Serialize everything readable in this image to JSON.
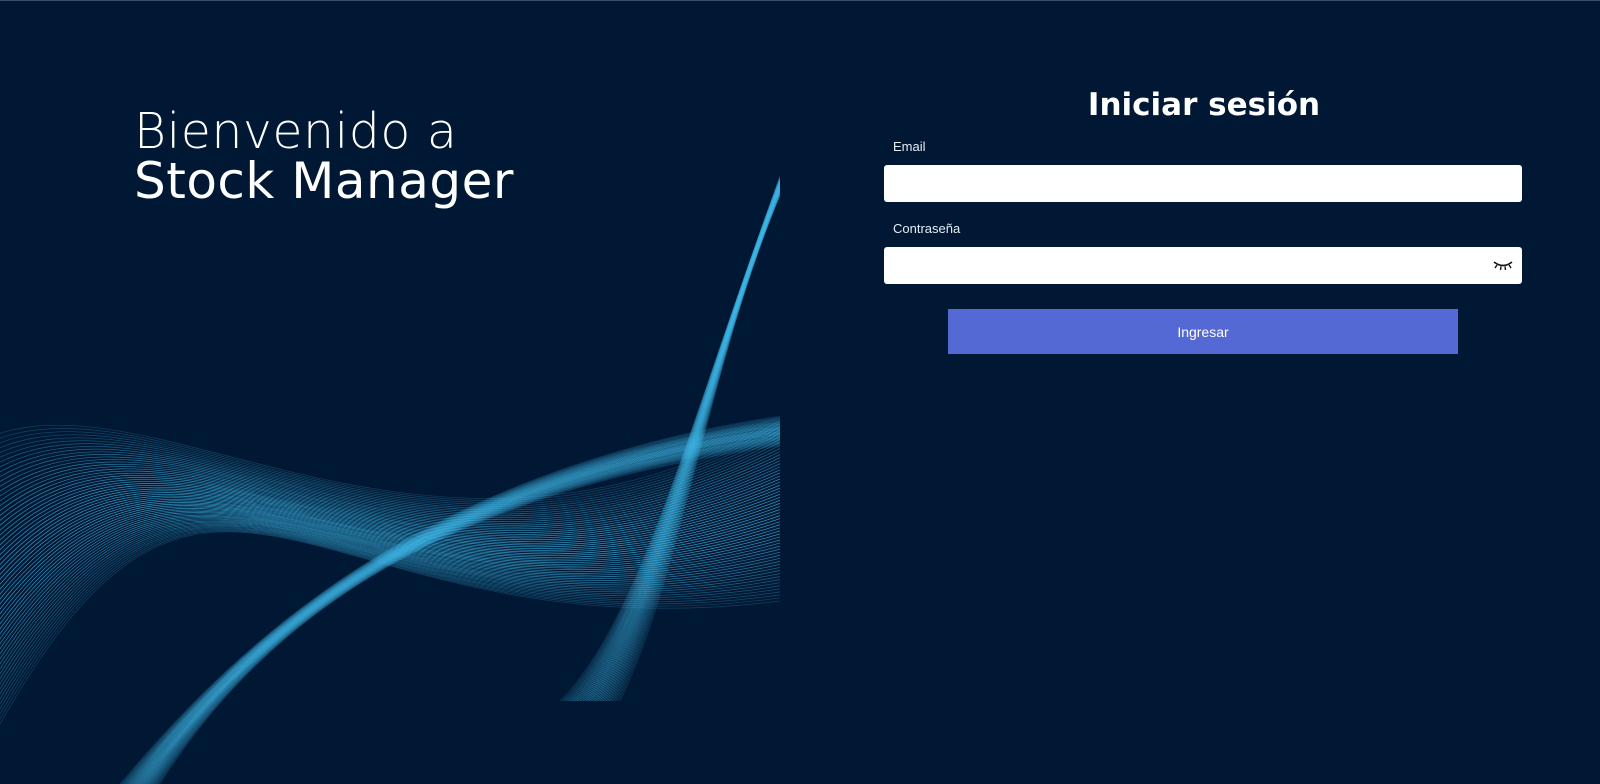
{
  "welcome": {
    "line1": "Bienvenido a",
    "line2": "Stock Manager"
  },
  "login": {
    "title": "Iniciar sesión",
    "email_label": "Email",
    "email_value": "",
    "password_label": "Contraseña",
    "password_value": "",
    "submit_label": "Ingresar",
    "toggle_icon": "eye-closed-icon"
  },
  "colors": {
    "background": "#001833",
    "accent": "#5469d4",
    "wave": "#3fb8e8"
  }
}
